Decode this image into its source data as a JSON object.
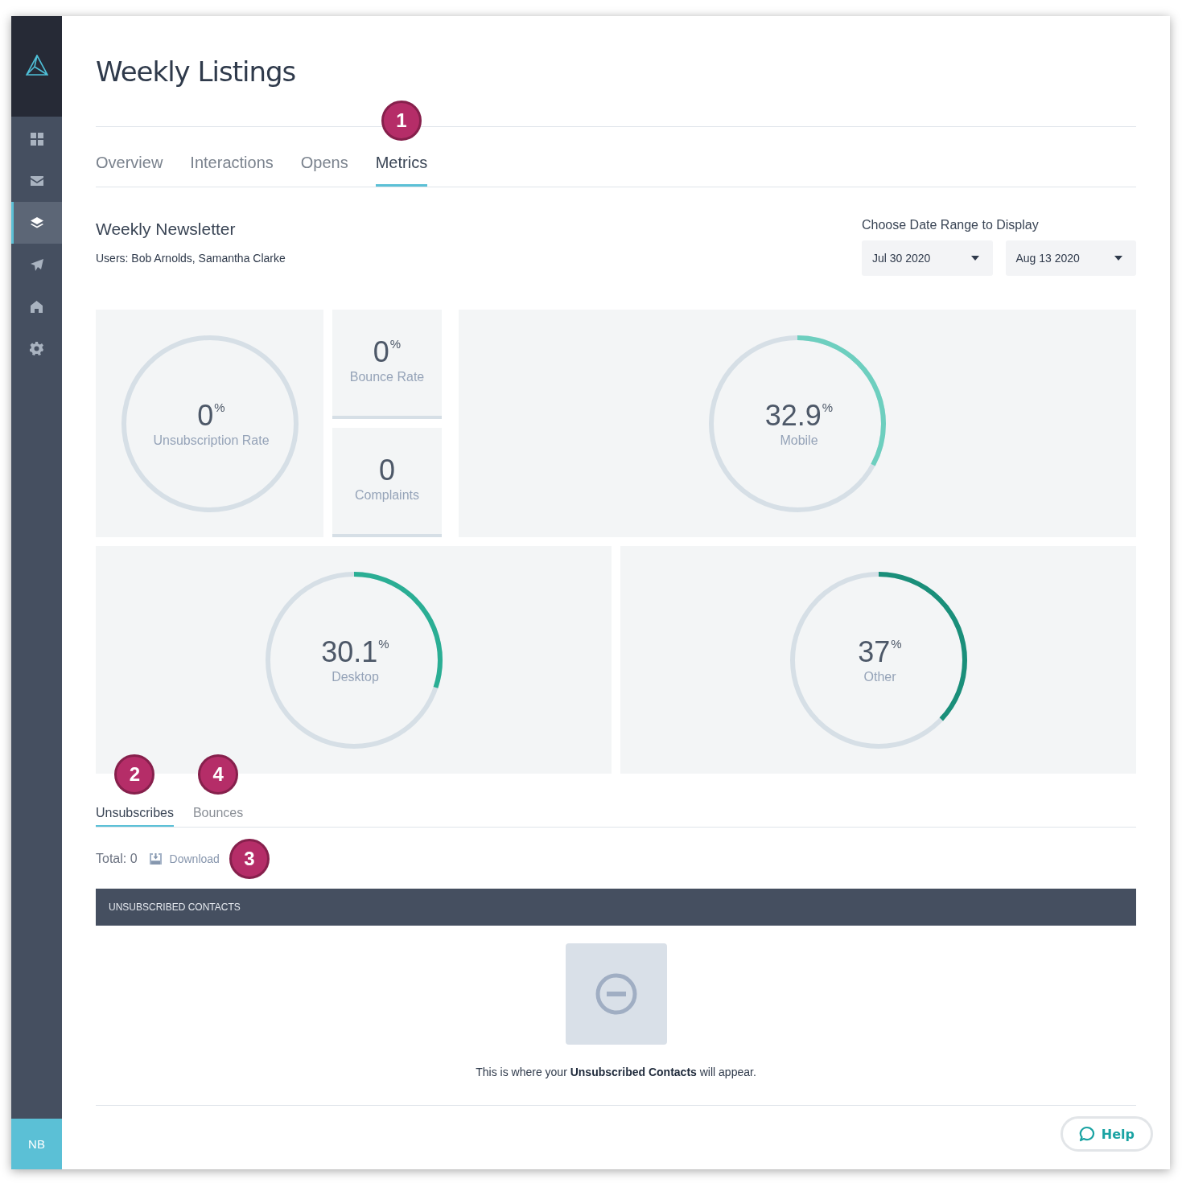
{
  "sidebar": {
    "items": [
      {
        "kind": "dashboard",
        "selected": false
      },
      {
        "kind": "mail",
        "selected": false
      },
      {
        "kind": "layers",
        "selected": true
      },
      {
        "kind": "send",
        "selected": false
      },
      {
        "kind": "home",
        "selected": false
      },
      {
        "kind": "settings",
        "selected": false
      }
    ],
    "user_initials": "NB"
  },
  "page_title": "Weekly Listings",
  "tabs": [
    {
      "label": "Overview",
      "selected": false
    },
    {
      "label": "Interactions",
      "selected": false
    },
    {
      "label": "Opens",
      "selected": false
    },
    {
      "label": "Metrics",
      "selected": true,
      "badge": "1"
    }
  ],
  "newsletter": {
    "title": "Weekly Newsletter",
    "users": "Users: Bob Arnolds, Samantha Clarke"
  },
  "date_range": {
    "label": "Choose Date Range to Display",
    "from": "Jul 30 2020",
    "to": "Aug 13 2020"
  },
  "stats": {
    "unsubscription": {
      "value": "0",
      "unit": "%",
      "label": "Unsubscription Rate"
    },
    "bounce": {
      "value": "0",
      "unit": "%",
      "label": "Bounce Rate"
    },
    "complaints": {
      "value": "0",
      "label": "Complaints"
    },
    "devices": [
      {
        "value": "32.9",
        "unit": "%",
        "label": "Mobile",
        "color": "#6dcfbf"
      },
      {
        "value": "30.1",
        "unit": "%",
        "label": "Desktop",
        "color": "#2aae94"
      },
      {
        "value": "37",
        "unit": "%",
        "label": "Other",
        "color": "#1a8f7a"
      }
    ]
  },
  "subtabs": [
    {
      "label": "Unsubscribes",
      "selected": true,
      "badge": "2"
    },
    {
      "label": "Bounces",
      "selected": false,
      "badge": "4"
    }
  ],
  "total": "Total: 0",
  "download": {
    "label": "Download",
    "badge": "3"
  },
  "table": {
    "header": "UNSUBSCRIBED CONTACTS",
    "empty_message": "This is where your **Unsubscribed Contacts** will appear."
  },
  "help": "Help"
}
